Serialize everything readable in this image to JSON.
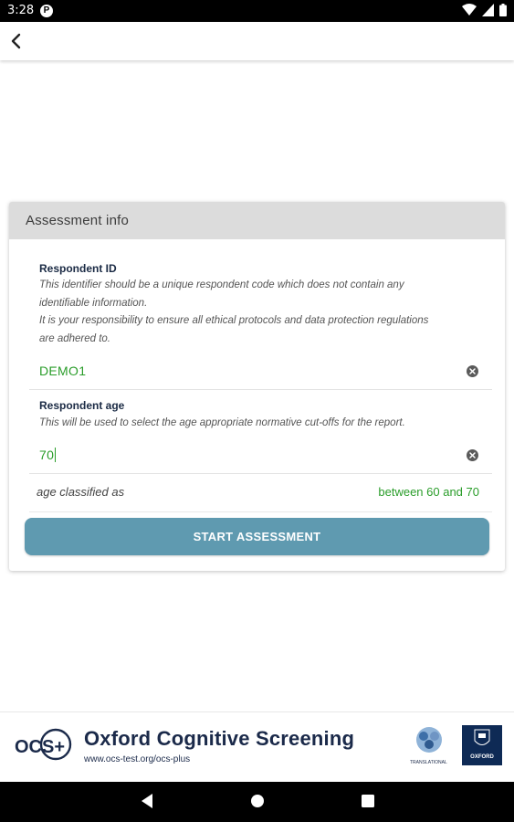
{
  "status_bar": {
    "time": "3:28",
    "app_badge": "P"
  },
  "card": {
    "title": "Assessment info",
    "respondent_id": {
      "label": "Respondent ID",
      "help_1": "This identifier should be a unique respondent code which does not contain any",
      "help_2": "identifiable information.",
      "help_3": "It is your responsibility to ensure all ethical protocols and data protection regulations",
      "help_4": "are adhered to.",
      "value": "DEMO1"
    },
    "respondent_age": {
      "label": "Respondent age",
      "help": "This will be used to select the age appropriate normative cut-offs for the report.",
      "value": "70"
    },
    "age_classification": {
      "label": "age classified as",
      "value": "between 60 and 70"
    },
    "start_button": "START ASSESSMENT"
  },
  "footer": {
    "logo_text": "OCS+",
    "title": "Oxford Cognitive Screening",
    "url": "www.ocs-test.org/ocs-plus",
    "translation_label": "TRANSLATIONAL",
    "oxford_label": "OXFORD"
  },
  "colors": {
    "accent_green": "#2a9d2a",
    "button_blue": "#5f9ab0",
    "header_gray": "#dcdcdc",
    "navy": "#1b2a4a"
  }
}
